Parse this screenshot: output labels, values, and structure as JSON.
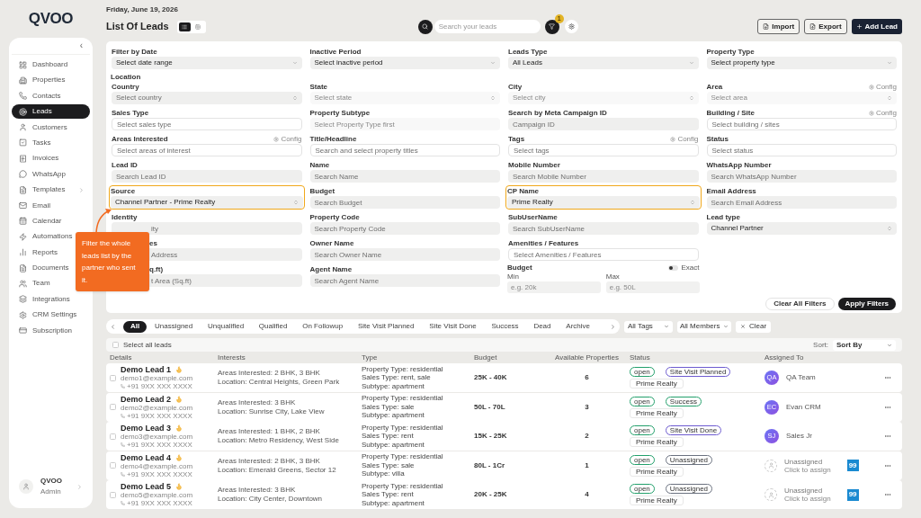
{
  "sidebar": {
    "logo": "QVOO",
    "collapse": "‹",
    "items": [
      {
        "label": "Dashboard",
        "selected": false,
        "submenu": false
      },
      {
        "label": "Properties",
        "selected": false,
        "submenu": false
      },
      {
        "label": "Contacts",
        "selected": false,
        "submenu": false
      },
      {
        "label": "Leads",
        "selected": true,
        "submenu": false
      },
      {
        "label": "Customers",
        "selected": false,
        "submenu": false
      },
      {
        "label": "Tasks",
        "selected": false,
        "submenu": false
      },
      {
        "label": "Invoices",
        "selected": false,
        "submenu": false
      },
      {
        "label": "WhatsApp",
        "selected": false,
        "submenu": false
      },
      {
        "label": "Templates",
        "selected": false,
        "submenu": true
      },
      {
        "label": "Email",
        "selected": false,
        "submenu": false
      },
      {
        "label": "Calendar",
        "selected": false,
        "submenu": false
      },
      {
        "label": "Automations",
        "selected": false
      },
      {
        "label": "Reports",
        "selected": false
      },
      {
        "label": "Documents",
        "selected": false
      },
      {
        "label": "Team",
        "selected": false
      },
      {
        "label": "Integrations",
        "selected": false,
        "submenu": false
      },
      {
        "label": "CRM Settings",
        "selected": false,
        "submenu": false
      },
      {
        "label": "Subscription",
        "selected": false,
        "submenu": false
      }
    ],
    "user": {
      "name": "QVOO",
      "role": "Admin"
    }
  },
  "header": {
    "date": "Friday, June 19, 2026",
    "title": "List Of Leads",
    "views": [
      {
        "selected": true
      },
      {
        "selected": false
      }
    ],
    "search": {
      "placeholder": "Search your leads"
    },
    "filter_badge": "1",
    "buttons": [
      {
        "label": "Import",
        "kind": "import"
      },
      {
        "label": "Export",
        "kind": "export"
      },
      {
        "label": "Add Lead",
        "kind": "add"
      }
    ]
  },
  "filters": {
    "rows": [
      {
        "cells": [
          {
            "label": "Filter by Date",
            "kind": "select",
            "value": "Select date range",
            "disabled": false,
            "highlighted": false
          },
          {
            "label": "Inactive Period",
            "kind": "select",
            "value": "Select inactive period",
            "disabled": false,
            "highlighted": false
          },
          {
            "label": "Leads Type",
            "kind": "select",
            "value": "All Leads",
            "disabled": false,
            "highlighted": false
          },
          {
            "label": "Property Type",
            "kind": "select",
            "value": "Select property type",
            "disabled": false,
            "highlighted": false
          }
        ]
      },
      {
        "section": "Location",
        "cells": [
          {
            "label": "Country",
            "kind": "stepper",
            "placeholder": "Select country",
            "disabled": false,
            "highlighted": false
          },
          {
            "label": "State",
            "kind": "stepper",
            "placeholder": "Select state",
            "disabled": true,
            "highlighted": false
          },
          {
            "label": "City",
            "kind": "stepper",
            "placeholder": "Select city",
            "disabled": true,
            "highlighted": false
          },
          {
            "label": "Area",
            "kind": "stepper",
            "placeholder": "Select area",
            "config": "Config",
            "disabled": true,
            "highlighted": false
          }
        ]
      },
      {
        "cells": [
          {
            "label": "Sales Type",
            "kind": "outlined",
            "placeholder": "Select sales type",
            "disabled": false,
            "highlighted": false
          },
          {
            "label": "Property Subtype",
            "kind": "text",
            "placeholder": "Select Property Type first",
            "disabled": true,
            "highlighted": false
          },
          {
            "label": "Search by Meta Campaign ID",
            "kind": "text",
            "placeholder": "Campaign ID",
            "disabled": false,
            "highlighted": false
          },
          {
            "label": "Building / Site",
            "kind": "outlined",
            "placeholder": "Select building / sites",
            "config": "Config",
            "disabled": false,
            "highlighted": false
          }
        ]
      },
      {
        "cells": [
          {
            "label": "Areas Interested",
            "kind": "outlined",
            "placeholder": "Select areas of interest",
            "config": "Config",
            "disabled": false,
            "highlighted": false
          },
          {
            "label": "Title/Headline",
            "kind": "outlined",
            "placeholder": "Search and select property titles",
            "disabled": false,
            "highlighted": false
          },
          {
            "label": "Tags",
            "kind": "outlined",
            "placeholder": "Select tags",
            "config": "Config",
            "disabled": false,
            "highlighted": false
          },
          {
            "label": "Status",
            "kind": "outlined",
            "placeholder": "Select status",
            "disabled": false,
            "highlighted": false
          }
        ]
      },
      {
        "cells": [
          {
            "label": "Lead ID",
            "kind": "text",
            "placeholder": "Search Lead ID",
            "disabled": false,
            "highlighted": false
          },
          {
            "label": "Name",
            "kind": "text",
            "placeholder": "Search Name",
            "disabled": false,
            "highlighted": false
          },
          {
            "label": "Mobile Number",
            "kind": "text",
            "placeholder": "Search Mobile Number",
            "disabled": false,
            "highlighted": false
          },
          {
            "label": "WhatsApp Number",
            "kind": "text",
            "placeholder": "Search WhatsApp Number",
            "disabled": false,
            "highlighted": false
          }
        ]
      },
      {
        "cells": [
          {
            "label": "Source",
            "kind": "stepper",
            "value": "Channel Partner - Prime Realty",
            "disabled": false,
            "highlighted": true
          },
          {
            "label": "Budget",
            "kind": "text",
            "placeholder": "Search Budget",
            "disabled": false,
            "highlighted": false
          },
          {
            "label": "CP Name",
            "kind": "stepper",
            "value": "Prime Realty",
            "disabled": false,
            "highlighted": true
          },
          {
            "label": "Email Address",
            "kind": "text",
            "placeholder": "Search Email Address",
            "disabled": false,
            "highlighted": false
          }
        ]
      },
      {
        "cells": [
          {
            "label": "Identity",
            "kind": "text",
            "placeholder": "ity",
            "disabled": false,
            "highlighted": false,
            "covered": true
          },
          {
            "label": "Property Code",
            "kind": "text",
            "placeholder": "Search Property Code",
            "disabled": false,
            "highlighted": false
          },
          {
            "label": "SubUserName",
            "kind": "text",
            "placeholder": "Search SubUserName",
            "disabled": false,
            "highlighted": false
          },
          {
            "label": "Lead type",
            "kind": "stepper",
            "value": "Channel Partner",
            "disabled": false,
            "highlighted": false
          }
        ]
      },
      {
        "cells": [
          {
            "label": "es",
            "kind": "text",
            "placeholder": "Address",
            "disabled": false,
            "highlighted": false,
            "covered": true,
            "label_covered": true
          },
          {
            "label": "Owner Name",
            "kind": "text",
            "placeholder": "Search Owner Name",
            "disabled": false,
            "highlighted": false
          },
          {
            "label": "Amenities / Features",
            "kind": "outlined",
            "placeholder": "Select Amenities / Features",
            "disabled": false,
            "highlighted": false
          },
          null
        ]
      },
      {
        "cells": [
          {
            "label": "q.ft)",
            "kind": "text",
            "placeholder": "t Area (Sq.ft)",
            "disabled": false,
            "highlighted": false,
            "covered": true,
            "label_covered": true
          },
          {
            "label": "Agent Name",
            "kind": "text",
            "placeholder": "Search Agent Name",
            "disabled": false,
            "highlighted": false
          },
          {
            "label": "Budget",
            "kind": "range",
            "toggle": {
              "label": "Exact",
              "on": false
            },
            "min": {
              "label": "Min",
              "placeholder": "e.g. 20k"
            },
            "max": {
              "label": "Max",
              "placeholder": "e.g. 50L"
            }
          },
          null
        ]
      }
    ],
    "buttons": [
      {
        "label": "Clear All Filters",
        "kind": "secondary"
      },
      {
        "label": "Apply Filters",
        "kind": "primary"
      }
    ]
  },
  "callout": "Filter the whole leads list by the partner who sent it.",
  "tabs": [
    {
      "label": "All",
      "selected": true
    },
    {
      "label": "Unassigned",
      "selected": false
    },
    {
      "label": "Unqualified",
      "selected": false
    },
    {
      "label": "Qualified",
      "selected": false
    },
    {
      "label": "On Followup",
      "selected": false
    },
    {
      "label": "Site Visit Planned",
      "selected": false
    },
    {
      "label": "Site Visit Done",
      "selected": false
    },
    {
      "label": "Success",
      "selected": false
    },
    {
      "label": "Dead",
      "selected": false
    },
    {
      "label": "Archive",
      "selected": false
    }
  ],
  "list_filters": {
    "tags": "All Tags",
    "members": "All Members",
    "clear": "Clear"
  },
  "toolbar": {
    "select_all": {
      "label": "Select all leads",
      "checked": false
    },
    "sort_label": "Sort:",
    "sort_value": "Sort By"
  },
  "table": {
    "columns": [
      "Details",
      "Interests",
      "Type",
      "Budget",
      "Available Properties",
      "Status",
      "Assigned To"
    ],
    "rows": [
      {
        "name": "Demo Lead 1",
        "hot": true,
        "checked": false,
        "email": "demo1@example.com",
        "phone": "+91 9XX XXX XXXX",
        "interests": [
          "Areas Interested: 2 BHK, 3 BHK",
          "Location: Central Heights, Green Park"
        ],
        "type": [
          "Property Type: residential",
          "Sales Type: rent, sale",
          "Subtype: apartment"
        ],
        "budget": "25K - 40K",
        "available": "6",
        "status": [
          {
            "label": "open",
            "color": "#22a06b"
          },
          {
            "label": "Site Visit Planned",
            "color": "#6d5bd0"
          }
        ],
        "source": "Prime Realty",
        "assignee": {
          "kind": "user",
          "initials": "QA",
          "name": "QA Team"
        }
      },
      {
        "name": "Demo Lead 2",
        "hot": true,
        "checked": false,
        "email": "demo2@example.com",
        "phone": "+91 9XX XXX XXXX",
        "interests": [
          "Areas Interested: 3 BHK",
          "Location: Sunrise City, Lake View"
        ],
        "type": [
          "Property Type: residential",
          "Sales Type: sale",
          "Subtype: apartment"
        ],
        "budget": "50L - 70L",
        "available": "3",
        "status": [
          {
            "label": "open",
            "color": "#22a06b"
          },
          {
            "label": "Success",
            "color": "#22a06b"
          }
        ],
        "source": "Prime Realty",
        "assignee": {
          "kind": "user",
          "initials": "EC",
          "name": "Evan CRM"
        }
      },
      {
        "name": "Demo Lead 3",
        "hot": true,
        "checked": false,
        "email": "demo3@example.com",
        "phone": "+91 9XX XXX XXXX",
        "interests": [
          "Areas Interested: 1 BHK, 2 BHK",
          "Location: Metro Residency, West Side"
        ],
        "type": [
          "Property Type: residential",
          "Sales Type: rent",
          "Subtype: apartment"
        ],
        "budget": "15K - 25K",
        "available": "2",
        "status": [
          {
            "label": "open",
            "color": "#22a06b"
          },
          {
            "label": "Site Visit Done",
            "color": "#6d5bd0"
          }
        ],
        "source": "Prime Realty",
        "assignee": {
          "kind": "user",
          "initials": "SJ",
          "name": "Sales Jr"
        }
      },
      {
        "name": "Demo Lead 4",
        "hot": true,
        "checked": false,
        "email": "demo4@example.com",
        "phone": "+91 9XX XXX XXXX",
        "interests": [
          "Areas Interested: 2 BHK, 3 BHK",
          "Location: Emerald Greens, Sector 12"
        ],
        "type": [
          "Property Type: residential",
          "Sales Type: sale",
          "Subtype: villa"
        ],
        "budget": "80L - 1Cr",
        "available": "1",
        "status": [
          {
            "label": "open",
            "color": "#22a06b"
          },
          {
            "label": "Unassigned",
            "color": "#6b7280"
          }
        ],
        "source": "Prime Realty",
        "assignee": {
          "kind": "unassigned",
          "name": "Unassigned",
          "hint": "Click to assign"
        },
        "portal": "99"
      },
      {
        "name": "Demo Lead 5",
        "hot": true,
        "checked": false,
        "email": "demo5@example.com",
        "phone": "+91 9XX XXX XXXX",
        "interests": [
          "Areas Interested: 3 BHK",
          "Location: City Center, Downtown"
        ],
        "type": [
          "Property Type: residential",
          "Sales Type: rent",
          "Subtype: apartment"
        ],
        "budget": "20K - 25K",
        "available": "4",
        "status": [
          {
            "label": "open",
            "color": "#22a06b"
          },
          {
            "label": "Unassigned",
            "color": "#6b7280"
          }
        ],
        "source": "Prime Realty",
        "assignee": {
          "kind": "unassigned",
          "name": "Unassigned",
          "hint": "Click to assign"
        },
        "portal": "99"
      }
    ]
  }
}
